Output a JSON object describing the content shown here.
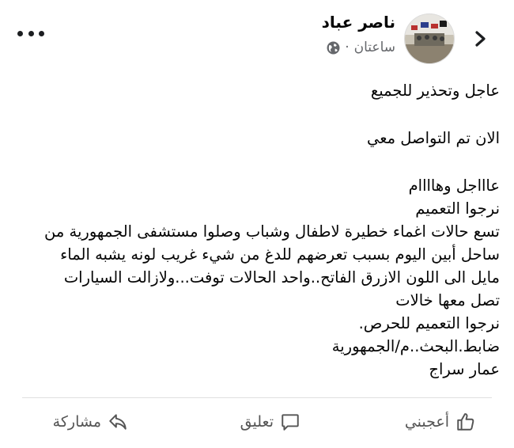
{
  "header": {
    "author_name": "ناصر عباد",
    "timestamp": "ساعتان",
    "separator": "·",
    "privacy_icon": "globe-icon",
    "back_icon": "chevron-left-icon",
    "more_icon": "more-horizontal-icon"
  },
  "post": {
    "lines": [
      "عاجل  وتحذير للجميع",
      "",
      "الان تم التواصل معي",
      "",
      "عاااجل وهاااام",
      "نرجوا التعميم",
      "تسع حالات اغماء خطيرة لاطفال وشباب وصلوا مستشفى الجمهورية من",
      "ساحل أبين اليوم بسبب تعرضهم للدغ من شيء غريب لونه يشبه الماء",
      "مايل الى اللون الازرق الفاتح..واحد الحالات توفت...ولازالت السيارات",
      "تصل معها خالات",
      "نرجوا التعميم للحرص.",
      "ضابط.البحث..م/الجمهورية",
      "عمار سراج"
    ]
  },
  "actions": {
    "like_label": "أعجبني",
    "comment_label": "تعليق",
    "share_label": "مشاركة"
  },
  "colors": {
    "text": "#050505",
    "secondary": "#65676b",
    "divider": "#e0e0e0"
  }
}
